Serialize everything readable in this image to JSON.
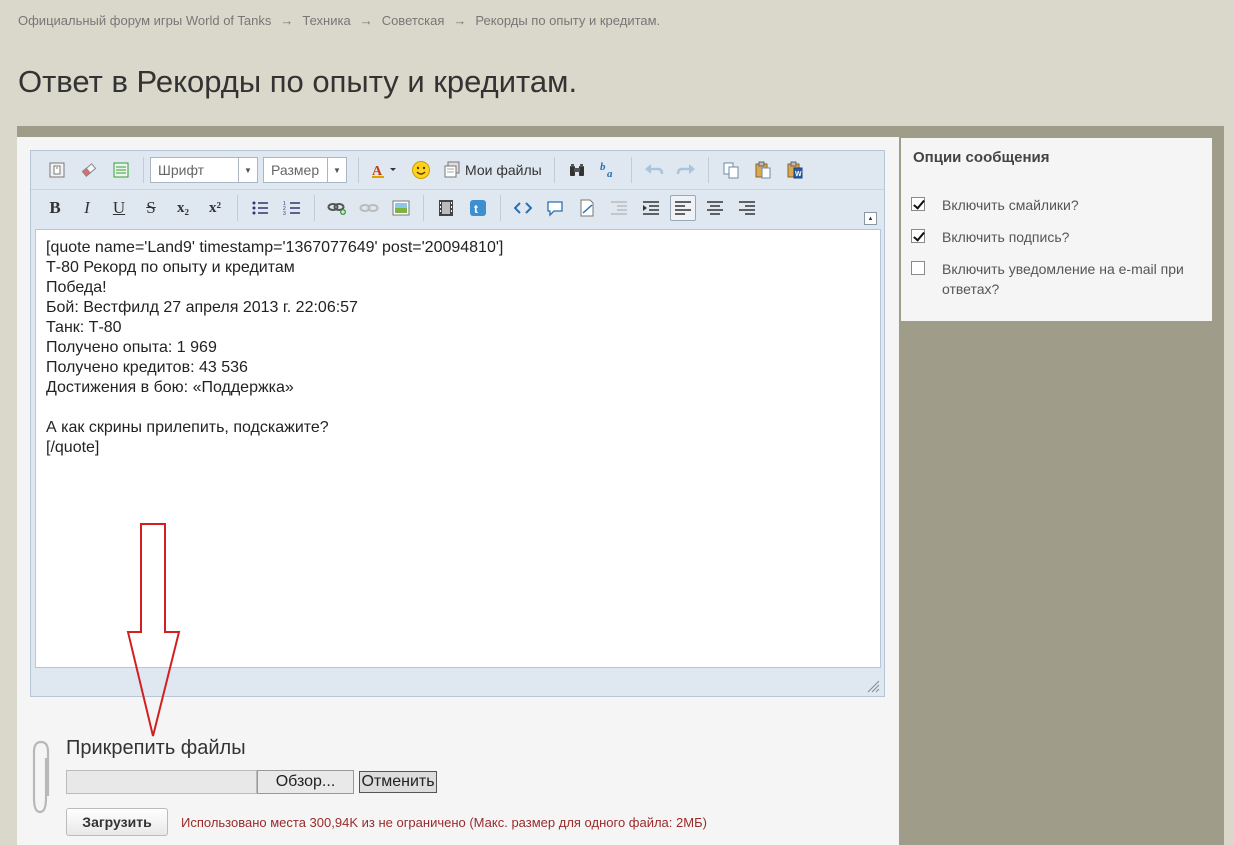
{
  "breadcrumb": {
    "items": [
      "Официальный форум игры World of Tanks",
      "Техника",
      "Советская",
      "Рекорды по опыту и кредитам."
    ],
    "separator": "→"
  },
  "page_title": "Ответ в Рекорды по опыту и кредитам.",
  "editor": {
    "font_select": "Шрифт",
    "size_select": "Размер",
    "my_files_label": "Мои файлы",
    "content": "[quote name='Land9' timestamp='1367077649' post='20094810']\nТ-80 Рекорд по опыту и кредитам\nПобеда!\nБой: Вестфилд 27 апреля 2013 г. 22:06:57\nТанк: Т-80\nПолучено опыта: 1 969\nПолучено кредитов: 43 536\nДостижения в бою: «Поддержка»\n\nА как скрины прилепить, подскажите?\n[/quote]",
    "bold": "B",
    "italic": "I",
    "underline": "U",
    "strike": "S",
    "subscript": "x₂",
    "superscript": "x²"
  },
  "options": {
    "title": "Опции сообщения",
    "items": [
      {
        "label": "Включить смайлики?",
        "checked": true
      },
      {
        "label": "Включить подпись?",
        "checked": true
      },
      {
        "label": "Включить уведомление на e-mail при ответах?",
        "checked": false
      }
    ]
  },
  "attach": {
    "title": "Прикрепить файлы",
    "browse_label": "Обзор...",
    "cancel_label": "Отменить",
    "upload_label": "Загрузить",
    "usage_text": "Использовано места 300,94K из не ограничено (Макс. размер для одного файла: 2МБ)"
  },
  "colors": {
    "page_bg": "#dad8ca",
    "olive": "#a09c8a",
    "annotation_arrow": "#d22020",
    "usage_text": "#9a2b2b"
  }
}
